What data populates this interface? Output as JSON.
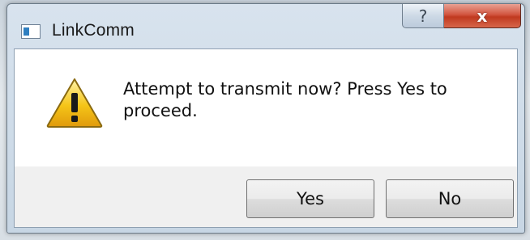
{
  "window": {
    "title": "LinkComm",
    "help_glyph": "?",
    "close_glyph": "x"
  },
  "dialog": {
    "icon": "warning-icon",
    "message": "Attempt to transmit now? Press Yes to proceed.",
    "buttons": {
      "yes_label": "Yes",
      "no_label": "No"
    }
  },
  "colors": {
    "close_button": "#c7432a",
    "warning_fill": "#f5c518",
    "button_area": "#f0f0f0"
  }
}
